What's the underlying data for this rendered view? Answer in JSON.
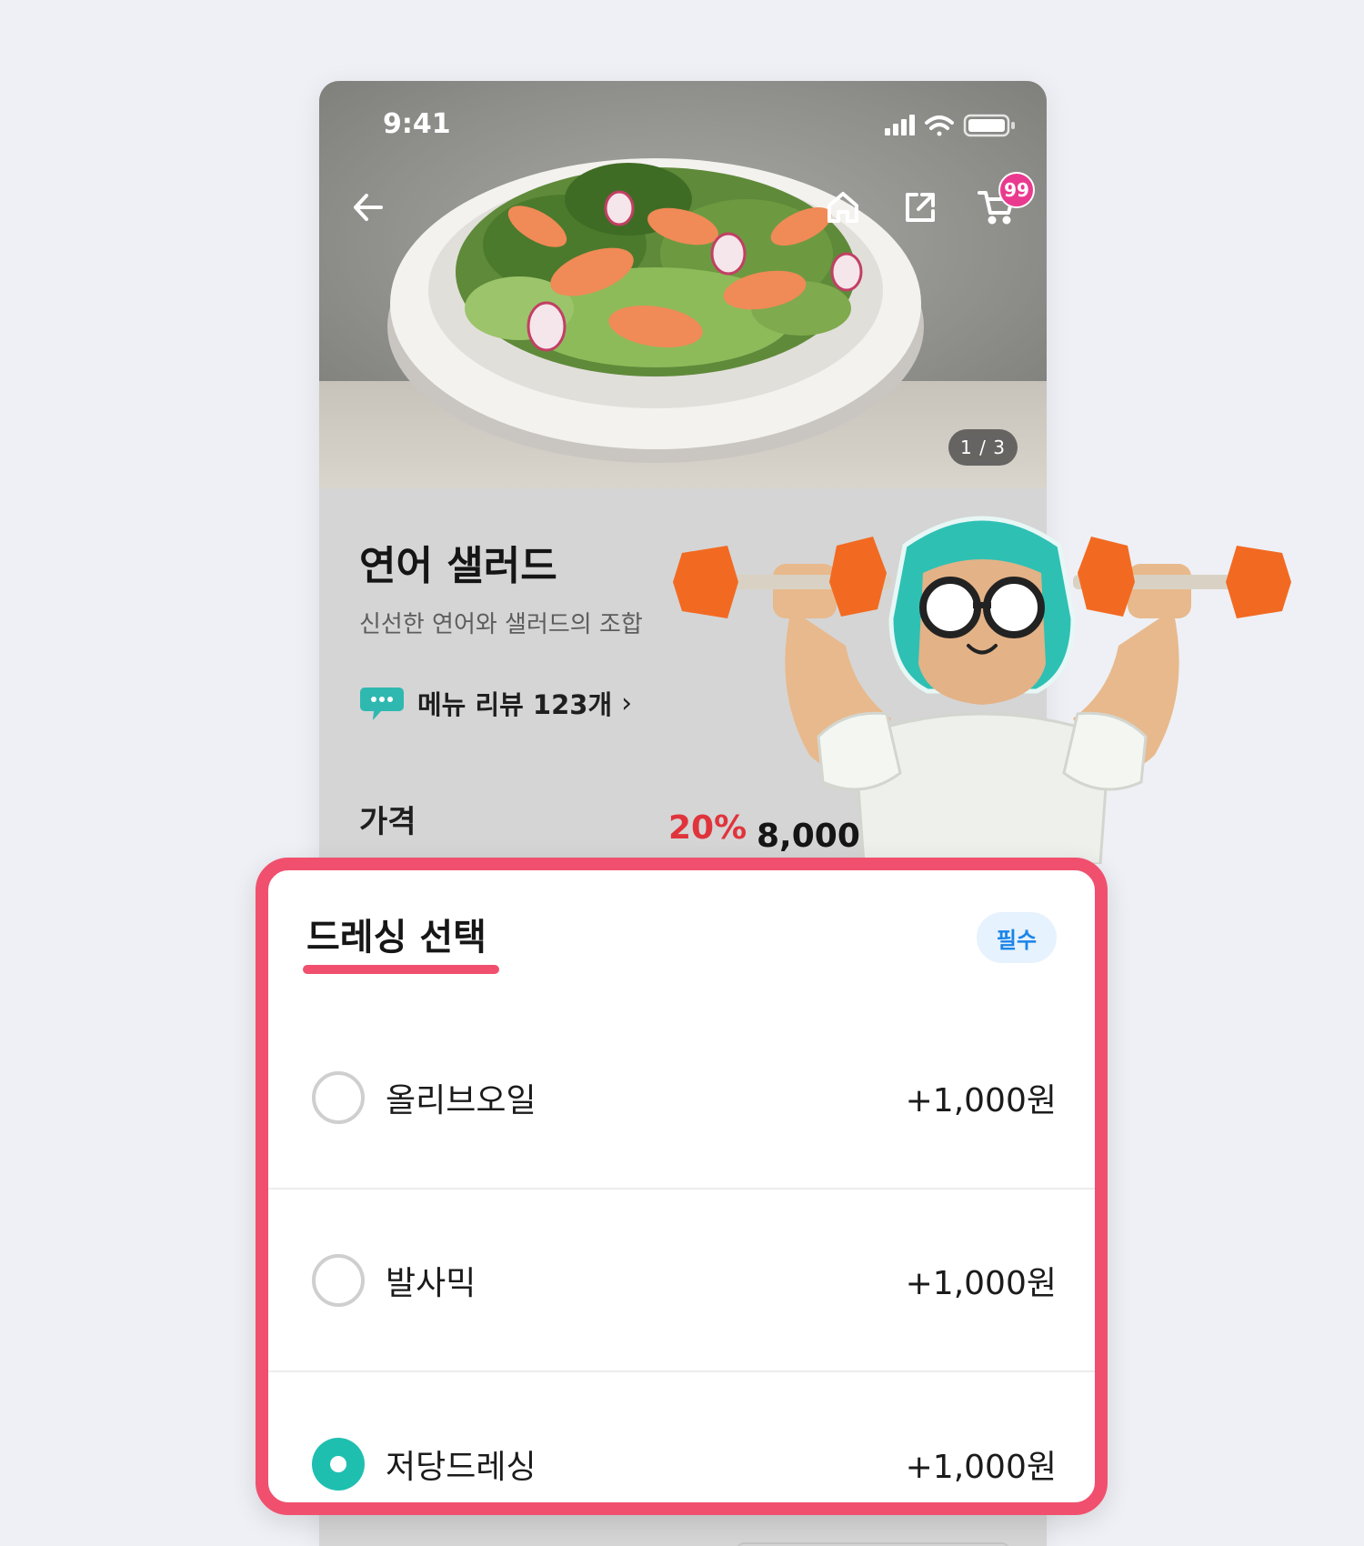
{
  "status_bar": {
    "time": "9:41"
  },
  "header": {
    "cart_count": "99"
  },
  "image": {
    "counter": "1 / 3"
  },
  "product": {
    "name": "연어 샐러드",
    "description": "신선한 연어와 샐러드의 조합",
    "review_link": "메뉴 리뷰 123개",
    "price_label": "가격",
    "discount": "20%",
    "price": "8,000원"
  },
  "option_group": {
    "title": "드레싱 선택",
    "badge": "필수",
    "options": [
      {
        "label": "올리브오일",
        "price": "+1,000원",
        "selected": false
      },
      {
        "label": "발사믹",
        "price": "+1,000원",
        "selected": false
      },
      {
        "label": "저당드레싱",
        "price": "+1,000원",
        "selected": true
      }
    ]
  },
  "colors": {
    "accent": "#f0506e",
    "selected": "#1fbfb0",
    "discount": "#e0343c",
    "badge_bg": "#e6f2fd",
    "badge_text": "#1a84e8",
    "cart_badge": "#ea3a8f"
  },
  "icons": [
    "back-arrow-icon",
    "home-icon",
    "share-icon",
    "cart-icon",
    "signal-icon",
    "wifi-icon",
    "battery-icon",
    "chat-bubble-icon",
    "chevron-right-icon"
  ]
}
